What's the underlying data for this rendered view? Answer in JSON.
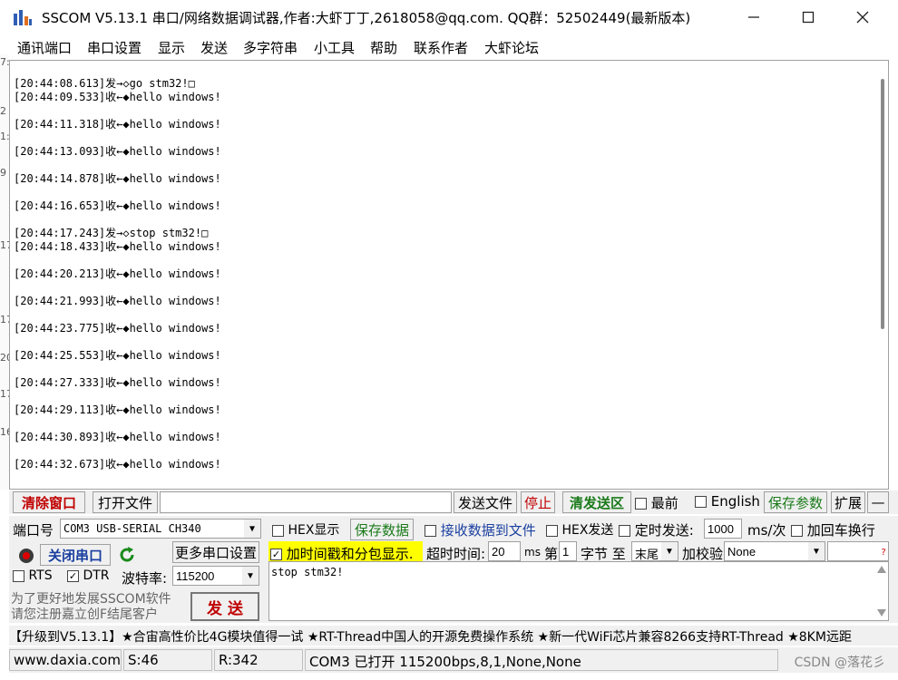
{
  "window": {
    "title": "SSCOM V5.13.1 串口/网络数据调试器,作者:大虾丁丁,2618058@qq.com. QQ群：52502449(最新版本)"
  },
  "menu": [
    "通讯端口",
    "串口设置",
    "显示",
    "发送",
    "多字符串",
    "小工具",
    "帮助",
    "联系作者",
    "大虾论坛"
  ],
  "left_strip": [
    "7:",
    "2",
    "1:",
    "9",
    "17",
    "17",
    "20",
    "17",
    "16"
  ],
  "recv_lines": [
    "[20:44:08.613]发→◇go stm32!□",
    "[20:44:09.533]收←◆hello windows!",
    "[20:44:11.318]收←◆hello windows!",
    "[20:44:13.093]收←◆hello windows!",
    "[20:44:14.878]收←◆hello windows!",
    "[20:44:16.653]收←◆hello windows!",
    "[20:44:17.243]发→◇stop stm32!□",
    "[20:44:18.433]收←◆hello windows!",
    "[20:44:20.213]收←◆hello windows!",
    "[20:44:21.993]收←◆hello windows!",
    "[20:44:23.775]收←◆hello windows!",
    "[20:44:25.553]收←◆hello windows!",
    "[20:44:27.333]收←◆hello windows!",
    "[20:44:29.113]收←◆hello windows!",
    "[20:44:30.893]收←◆hello windows!",
    "[20:44:32.673]收←◆hello windows!"
  ],
  "toolbar": {
    "clear_window": "清除窗口",
    "open_file": "打开文件",
    "file_path": "",
    "send_file": "发送文件",
    "stop": "停止",
    "clear_send": "清发送区",
    "topmost": "最前",
    "english": "English",
    "save_params": "保存参数",
    "expand": "扩展",
    "collapse": "—"
  },
  "port": {
    "port_label": "端口号",
    "port_value": "COM3 USB-SERIAL CH340",
    "close_port": "关闭串口",
    "more_settings": "更多串口设置",
    "rts": "RTS",
    "dtr": "DTR",
    "baud_label": "波特率:",
    "baud_value": "115200",
    "promo": "为了更好地发展SSCOM软件\n请您注册嘉立创F结尾客户",
    "send_button": "发 送"
  },
  "options": {
    "hex_display": "HEX显示",
    "save_data": "保存数据",
    "recv_to_file": "接收数据到文件",
    "hex_send": "HEX发送",
    "timed_send": "定时发送:",
    "interval": "1000",
    "interval_unit": "ms/次",
    "add_crlf": "加回车换行",
    "timestamp": "加时间戳和分包显示.",
    "timeout_label": "超时时间:",
    "timeout_value": "20",
    "timeout_unit": "ms",
    "byte_no_label": "第",
    "byte_no_value": "1",
    "byte_label": "字节 至",
    "end_value": "末尾",
    "checksum_label": "加校验",
    "checksum_value": "None",
    "question": "?"
  },
  "send_text": "stop stm32!",
  "ticker": "【升级到V5.13.1】★合宙高性价比4G模块值得一试 ★RT-Thread中国人的开源免费操作系统 ★新一代WiFi芯片兼容8266支持RT-Thread ★8KM远距",
  "status": {
    "website": "www.daxia.com",
    "sent": "S:46",
    "received": "R:342",
    "port_state": "COM3 已打开  115200bps,8,1,None,None"
  },
  "watermark": "CSDN @落花彡",
  "colors": {
    "red_text": "#c00000",
    "green_text": "#1a7a1a",
    "highlight": "#ffff00",
    "blue_text": "#1a3fa0"
  }
}
